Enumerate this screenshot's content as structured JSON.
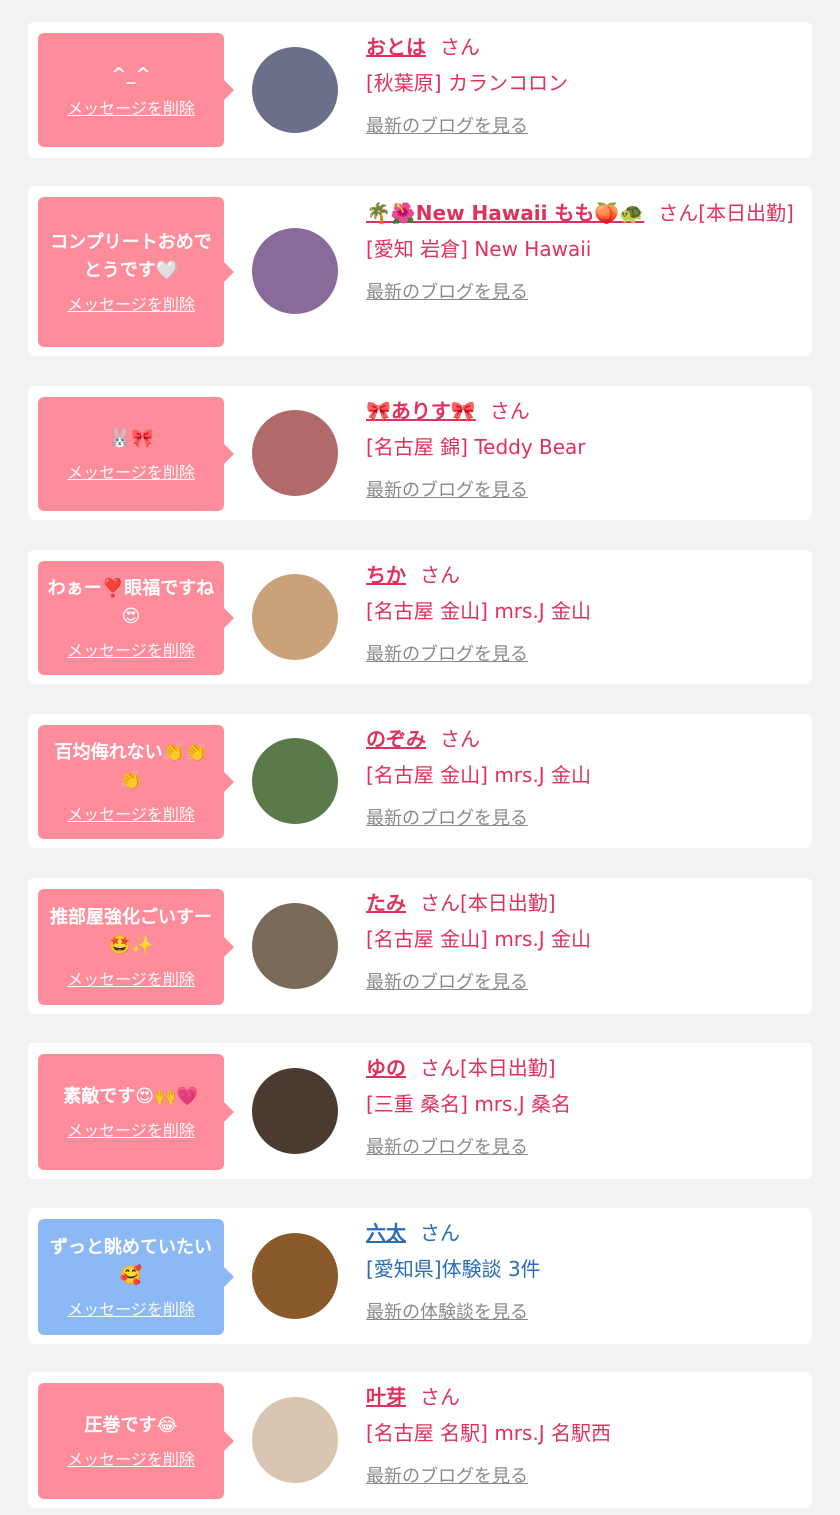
{
  "colors": {
    "pink_bubble": "#ff8c9a",
    "blue_bubble": "#8cb8f5",
    "name_pink": "#e0315c",
    "name_blue": "#2a6db5",
    "link_gray": "#8a8a8a"
  },
  "delete_label": "メッセージを削除",
  "items": [
    {
      "message": "^_^",
      "name": "おとは",
      "honorific": "さん",
      "shop": "[秋葉原] カランコロン",
      "link": "最新のブログを見る",
      "avatar_color": "#6b6f8a"
    },
    {
      "message": "コンプリートおめでとうです🤍",
      "name": "🌴🌺New Hawaii もも🍑🐢",
      "honorific": "さん[本日出勤]",
      "shop": "[愛知 岩倉] New Hawaii",
      "link": "最新のブログを見る",
      "avatar_color": "#8a6a9a"
    },
    {
      "message": "🐰🎀",
      "name": "🎀ありす🎀",
      "honorific": "さん",
      "shop": "[名古屋 錦] Teddy Bear",
      "link": "最新のブログを見る",
      "avatar_color": "#b06a6a"
    },
    {
      "message": "わぁー❣️眼福ですね😍",
      "name": "ちか",
      "honorific": "さん",
      "shop": "[名古屋 金山] mrs.J 金山",
      "link": "最新のブログを見る",
      "avatar_color": "#c9a27a"
    },
    {
      "message": "百均侮れない👏👏👏",
      "name": "のぞみ",
      "honorific": "さん",
      "shop": "[名古屋 金山] mrs.J 金山",
      "link": "最新のブログを見る",
      "avatar_color": "#5a7a4a"
    },
    {
      "message": "推部屋強化ごいすー🤩✨",
      "name": "たみ",
      "honorific": "さん[本日出勤]",
      "shop": "[名古屋 金山] mrs.J 金山",
      "link": "最新のブログを見る",
      "avatar_color": "#7a6a5a"
    },
    {
      "message": "素敵です😍🙌💗",
      "name": "ゆの",
      "honorific": "さん[本日出勤]",
      "shop": "[三重 桑名] mrs.J 桑名",
      "link": "最新のブログを見る",
      "avatar_color": "#4a3a30"
    },
    {
      "message": "ずっと眺めていたい🥰",
      "name": "六太",
      "honorific": "さん",
      "shop": "[愛知県]体験談 3件",
      "link": "最新の体験談を見る",
      "avatar_color": "#8a5a2a",
      "blue": true
    },
    {
      "message": "圧巻です😂",
      "name": "叶芽",
      "honorific": "さん",
      "shop": "[名古屋 名駅] mrs.J 名駅西",
      "link": "最新のブログを見る",
      "avatar_color": "#d8c4b0"
    }
  ]
}
